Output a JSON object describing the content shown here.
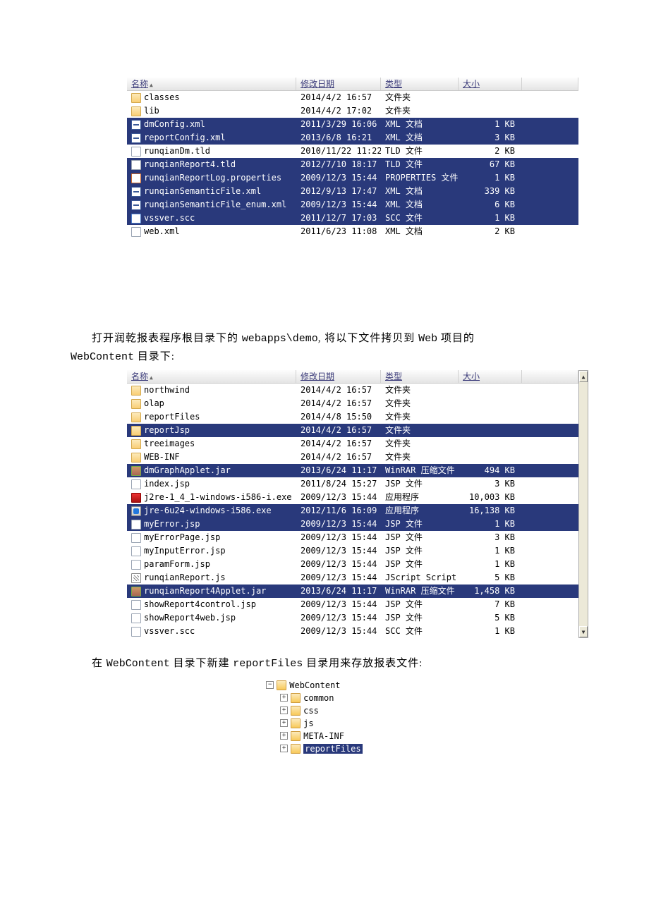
{
  "table1": {
    "headers": {
      "name": "名称",
      "modified": "修改日期",
      "type": "类型",
      "size": "大小"
    },
    "rows": [
      {
        "icon": "folder",
        "name": "classes",
        "modified": "2014/4/2 16:57",
        "type": "文件夹",
        "size": "",
        "sel": false
      },
      {
        "icon": "folder",
        "name": "lib",
        "modified": "2014/4/2 17:02",
        "type": "文件夹",
        "size": "",
        "sel": false
      },
      {
        "icon": "file-xml",
        "name": "dmConfig.xml",
        "modified": "2011/3/29 16:06",
        "type": "XML 文档",
        "size": "1 KB",
        "sel": true
      },
      {
        "icon": "file-xml",
        "name": "reportConfig.xml",
        "modified": "2013/6/8 16:21",
        "type": "XML 文档",
        "size": "3 KB",
        "sel": true
      },
      {
        "icon": "file",
        "name": "runqianDm.tld",
        "modified": "2010/11/22 11:22",
        "type": "TLD 文件",
        "size": "2 KB",
        "sel": false
      },
      {
        "icon": "file",
        "name": "runqianReport4.tld",
        "modified": "2012/7/10 18:17",
        "type": "TLD 文件",
        "size": "67 KB",
        "sel": true
      },
      {
        "icon": "file-prop",
        "name": "runqianReportLog.properties",
        "modified": "2009/12/3 15:44",
        "type": "PROPERTIES 文件",
        "size": "1 KB",
        "sel": true
      },
      {
        "icon": "file-xml",
        "name": "runqianSemanticFile.xml",
        "modified": "2012/9/13 17:47",
        "type": "XML 文档",
        "size": "339 KB",
        "sel": true
      },
      {
        "icon": "file-xml",
        "name": "runqianSemanticFile_enum.xml",
        "modified": "2009/12/3 15:44",
        "type": "XML 文档",
        "size": "6 KB",
        "sel": true
      },
      {
        "icon": "file-scc",
        "name": "vssver.scc",
        "modified": "2011/12/7 17:03",
        "type": "SCC 文件",
        "size": "1 KB",
        "sel": true
      },
      {
        "icon": "file",
        "name": "web.xml",
        "modified": "2011/6/23 11:08",
        "type": "XML 文档",
        "size": "2 KB",
        "sel": false
      }
    ]
  },
  "paragraph1a": "打开润乾报表程序根目录下的 ",
  "paragraph1b": "webapps\\demo",
  "paragraph1c": ", 将以下文件拷贝到 ",
  "paragraph1d": "Web",
  "paragraph1e": " 项目的 ",
  "paragraph1f": "WebContent",
  "paragraph1g": " 目录下:",
  "table2": {
    "headers": {
      "name": "名称",
      "modified": "修改日期",
      "type": "类型",
      "size": "大小"
    },
    "rows": [
      {
        "icon": "folder",
        "name": "northwind",
        "modified": "2014/4/2 16:57",
        "type": "文件夹",
        "size": "",
        "sel": false
      },
      {
        "icon": "folder",
        "name": "olap",
        "modified": "2014/4/2 16:57",
        "type": "文件夹",
        "size": "",
        "sel": false
      },
      {
        "icon": "folder",
        "name": "reportFiles",
        "modified": "2014/4/8 15:50",
        "type": "文件夹",
        "size": "",
        "sel": false
      },
      {
        "icon": "folder",
        "name": "reportJsp",
        "modified": "2014/4/2 16:57",
        "type": "文件夹",
        "size": "",
        "sel": true
      },
      {
        "icon": "folder",
        "name": "treeimages",
        "modified": "2014/4/2 16:57",
        "type": "文件夹",
        "size": "",
        "sel": false
      },
      {
        "icon": "folder",
        "name": "WEB-INF",
        "modified": "2014/4/2 16:57",
        "type": "文件夹",
        "size": "",
        "sel": false
      },
      {
        "icon": "jar",
        "name": "dmGraphApplet.jar",
        "modified": "2013/6/24 11:17",
        "type": "WinRAR 压缩文件",
        "size": "494 KB",
        "sel": true
      },
      {
        "icon": "file",
        "name": "index.jsp",
        "modified": "2011/8/24 15:27",
        "type": "JSP 文件",
        "size": "3 KB",
        "sel": false
      },
      {
        "icon": "exe",
        "name": "j2re-1_4_1-windows-i586-i.exe",
        "modified": "2009/12/3 15:44",
        "type": "应用程序",
        "size": "10,003 KB",
        "sel": false
      },
      {
        "icon": "exe2",
        "name": "jre-6u24-windows-i586.exe",
        "modified": "2012/11/6 16:09",
        "type": "应用程序",
        "size": "16,138 KB",
        "sel": true
      },
      {
        "icon": "file",
        "name": "myError.jsp",
        "modified": "2009/12/3 15:44",
        "type": "JSP 文件",
        "size": "1 KB",
        "sel": true
      },
      {
        "icon": "file",
        "name": "myErrorPage.jsp",
        "modified": "2009/12/3 15:44",
        "type": "JSP 文件",
        "size": "3 KB",
        "sel": false
      },
      {
        "icon": "file",
        "name": "myInputError.jsp",
        "modified": "2009/12/3 15:44",
        "type": "JSP 文件",
        "size": "1 KB",
        "sel": false
      },
      {
        "icon": "file",
        "name": "paramForm.jsp",
        "modified": "2009/12/3 15:44",
        "type": "JSP 文件",
        "size": "1 KB",
        "sel": false
      },
      {
        "icon": "js",
        "name": "runqianReport.js",
        "modified": "2009/12/3 15:44",
        "type": "JScript Script...",
        "size": "5 KB",
        "sel": false
      },
      {
        "icon": "jar",
        "name": "runqianReport4Applet.jar",
        "modified": "2013/6/24 11:17",
        "type": "WinRAR 压缩文件",
        "size": "1,458 KB",
        "sel": true
      },
      {
        "icon": "file",
        "name": "showReport4control.jsp",
        "modified": "2009/12/3 15:44",
        "type": "JSP 文件",
        "size": "7 KB",
        "sel": false
      },
      {
        "icon": "file",
        "name": "showReport4web.jsp",
        "modified": "2009/12/3 15:44",
        "type": "JSP 文件",
        "size": "5 KB",
        "sel": false
      },
      {
        "icon": "file",
        "name": "vssver.scc",
        "modified": "2009/12/3 15:44",
        "type": "SCC 文件",
        "size": "1 KB",
        "sel": false
      }
    ]
  },
  "paragraph2a": "在 ",
  "paragraph2b": "WebContent",
  "paragraph2c": " 目录下新建 ",
  "paragraph2d": "reportFiles",
  "paragraph2e": " 目录用来存放报表文件:",
  "tree": {
    "root": "WebContent",
    "children": [
      {
        "name": "common",
        "sel": false
      },
      {
        "name": "css",
        "sel": false
      },
      {
        "name": "js",
        "sel": false
      },
      {
        "name": "META-INF",
        "sel": false
      },
      {
        "name": "reportFiles",
        "sel": true
      }
    ]
  }
}
